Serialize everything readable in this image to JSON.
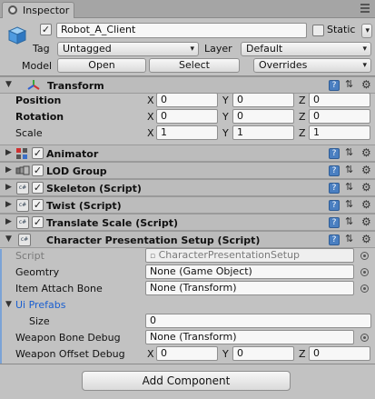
{
  "tab": {
    "title": "Inspector"
  },
  "gameobject": {
    "active_checked": "✓",
    "name": "Robot_A_Client",
    "static_label": "Static",
    "tag_label": "Tag",
    "tag_value": "Untagged",
    "layer_label": "Layer",
    "layer_value": "Default",
    "model_label": "Model",
    "open_label": "Open",
    "select_label": "Select",
    "overrides_value": "Overrides"
  },
  "transform": {
    "title": "Transform",
    "position": {
      "label": "Position",
      "x": "0",
      "y": "0",
      "z": "0"
    },
    "rotation": {
      "label": "Rotation",
      "x": "0",
      "y": "0",
      "z": "0"
    },
    "scale": {
      "label": "Scale",
      "x": "1",
      "y": "1",
      "z": "1"
    },
    "axis_x": "X",
    "axis_y": "Y",
    "axis_z": "Z"
  },
  "components": [
    {
      "title": "Animator",
      "checked": "✓",
      "icon": "animator-icon"
    },
    {
      "title": "LOD Group",
      "checked": "✓",
      "icon": "lod-group-icon"
    },
    {
      "title": "Skeleton (Script)",
      "checked": "✓",
      "icon": "script-icon"
    },
    {
      "title": "Twist (Script)",
      "checked": "✓",
      "icon": "script-icon"
    },
    {
      "title": "Translate Scale (Script)",
      "checked": "✓",
      "icon": "script-icon"
    }
  ],
  "character_presentation": {
    "title": "Character Presentation Setup (Script)",
    "script_label": "Script",
    "script_value": "CharacterPresentationSetup",
    "geomtry_label": "Geomtry",
    "geomtry_value": "None (Game Object)",
    "attach_label": "Item Attach Bone",
    "attach_value": "None (Transform)",
    "ui_prefabs_label": "Ui Prefabs",
    "size_label": "Size",
    "size_value": "0",
    "weapon_bone_label": "Weapon Bone Debug",
    "weapon_bone_value": "None (Transform)",
    "weapon_offset_label": "Weapon Offset Debug",
    "offset_x": "0",
    "offset_y": "0",
    "offset_z": "0"
  },
  "add_component": "Add Component",
  "colors": {
    "panel": "#c2c2c2",
    "header": "#bcbcbc",
    "accent_blue": "#1a5fd0"
  }
}
